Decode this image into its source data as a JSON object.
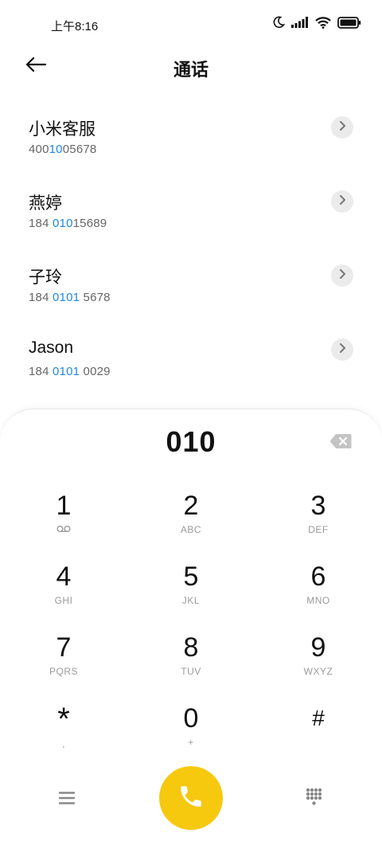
{
  "status_bar": {
    "time": "上午8:16",
    "icons": [
      "moon-icon",
      "signal-icon",
      "wifi-icon",
      "battery-icon"
    ]
  },
  "header": {
    "title": "通话",
    "back_icon": "arrow-left-icon"
  },
  "results": [
    {
      "name": "小米客服",
      "number_pre": "400",
      "number_match": "10",
      "number_post": "05678"
    },
    {
      "name": "燕婷",
      "number_pre": "184 ",
      "number_match": "010",
      "number_post": "15689"
    },
    {
      "name": "子玲",
      "number_pre": "184 ",
      "number_match": "0101",
      "number_post": " 5678"
    },
    {
      "name": "Jason",
      "number_pre": "184 ",
      "number_match": "0101",
      "number_post": " 0029"
    }
  ],
  "dialpad": {
    "input": "010",
    "keys": [
      {
        "digit": "1",
        "letters": ""
      },
      {
        "digit": "2",
        "letters": "ABC"
      },
      {
        "digit": "3",
        "letters": "DEF"
      },
      {
        "digit": "4",
        "letters": "GHI"
      },
      {
        "digit": "5",
        "letters": "JKL"
      },
      {
        "digit": "6",
        "letters": "MNO"
      },
      {
        "digit": "7",
        "letters": "PQRS"
      },
      {
        "digit": "8",
        "letters": "TUV"
      },
      {
        "digit": "9",
        "letters": "WXYZ"
      },
      {
        "digit": "*",
        "letters": ","
      },
      {
        "digit": "0",
        "letters": "+"
      },
      {
        "digit": "#",
        "letters": ""
      }
    ]
  },
  "colors": {
    "accent_yellow": "#f6c90e",
    "match_blue": "#1e88e5",
    "secondary_text": "#666666"
  }
}
